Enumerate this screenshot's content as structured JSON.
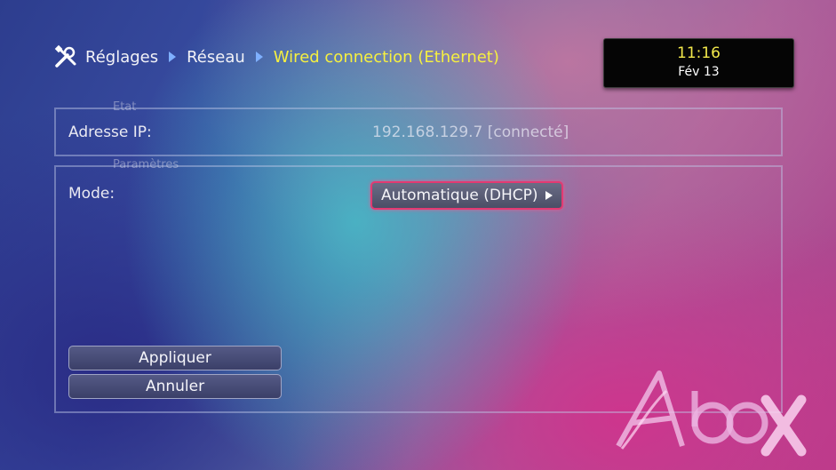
{
  "breadcrumb": {
    "items": [
      "Réglages",
      "Réseau"
    ],
    "current": "Wired connection (Ethernet)"
  },
  "clock": {
    "time": "11:16",
    "date": "Fév 13"
  },
  "status_section": {
    "legend": "Etat",
    "ip_label": "Adresse IP:",
    "ip_value": "192.168.129.7 [connecté]"
  },
  "params_section": {
    "legend": "Paramètres",
    "mode_label": "Mode:",
    "mode_value": "Automatique (DHCP)"
  },
  "buttons": {
    "apply": "Appliquer",
    "cancel": "Annuler"
  },
  "colors": {
    "accent_yellow": "#f6f040",
    "focus_pink": "#e33a72"
  }
}
